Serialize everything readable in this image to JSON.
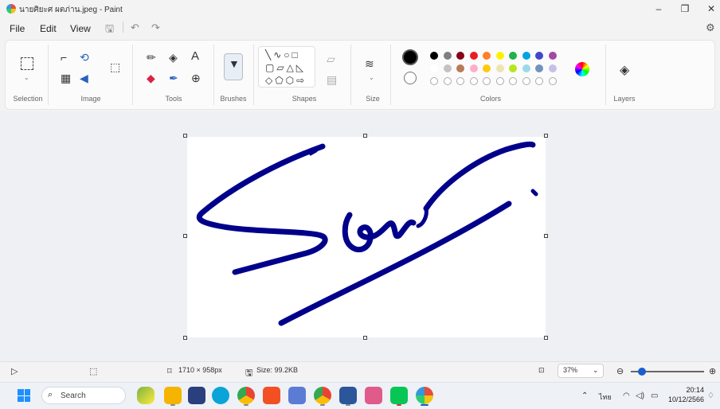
{
  "window": {
    "title": "นายศิยะศ ผตภ่าน.jpeg - Paint"
  },
  "menu": {
    "file": "File",
    "edit": "Edit",
    "view": "View"
  },
  "ribbon": {
    "groups": {
      "selection": "Selection",
      "image": "Image",
      "tools": "Tools",
      "brushes": "Brushes",
      "shapes": "Shapes",
      "size": "Size",
      "colors": "Colors",
      "layers": "Layers"
    },
    "text_tool": "A",
    "palette_row1": [
      "#000000",
      "#7f7f7f",
      "#880015",
      "#ed1c24",
      "#ff7f27",
      "#fff200",
      "#22b14c",
      "#00a2e8",
      "#3f48cc",
      "#a349a4"
    ],
    "palette_row2": [
      "#ffffff",
      "#c3c3c3",
      "#b97a57",
      "#ffaec9",
      "#ffc90e",
      "#efe4b0",
      "#b5e61d",
      "#99d9ea",
      "#7092be",
      "#c8bfe7"
    ],
    "primary_color": "#000000",
    "stroke_color": "#00008b"
  },
  "status": {
    "dimensions": "1710 × 958px",
    "size": "Size: 99.2KB",
    "zoom": "37%",
    "zoom_fraction": 0.15
  },
  "taskbar": {
    "search_placeholder": "Search",
    "lang": "ไทย",
    "time": "20:14",
    "date": "10/12/2566"
  }
}
